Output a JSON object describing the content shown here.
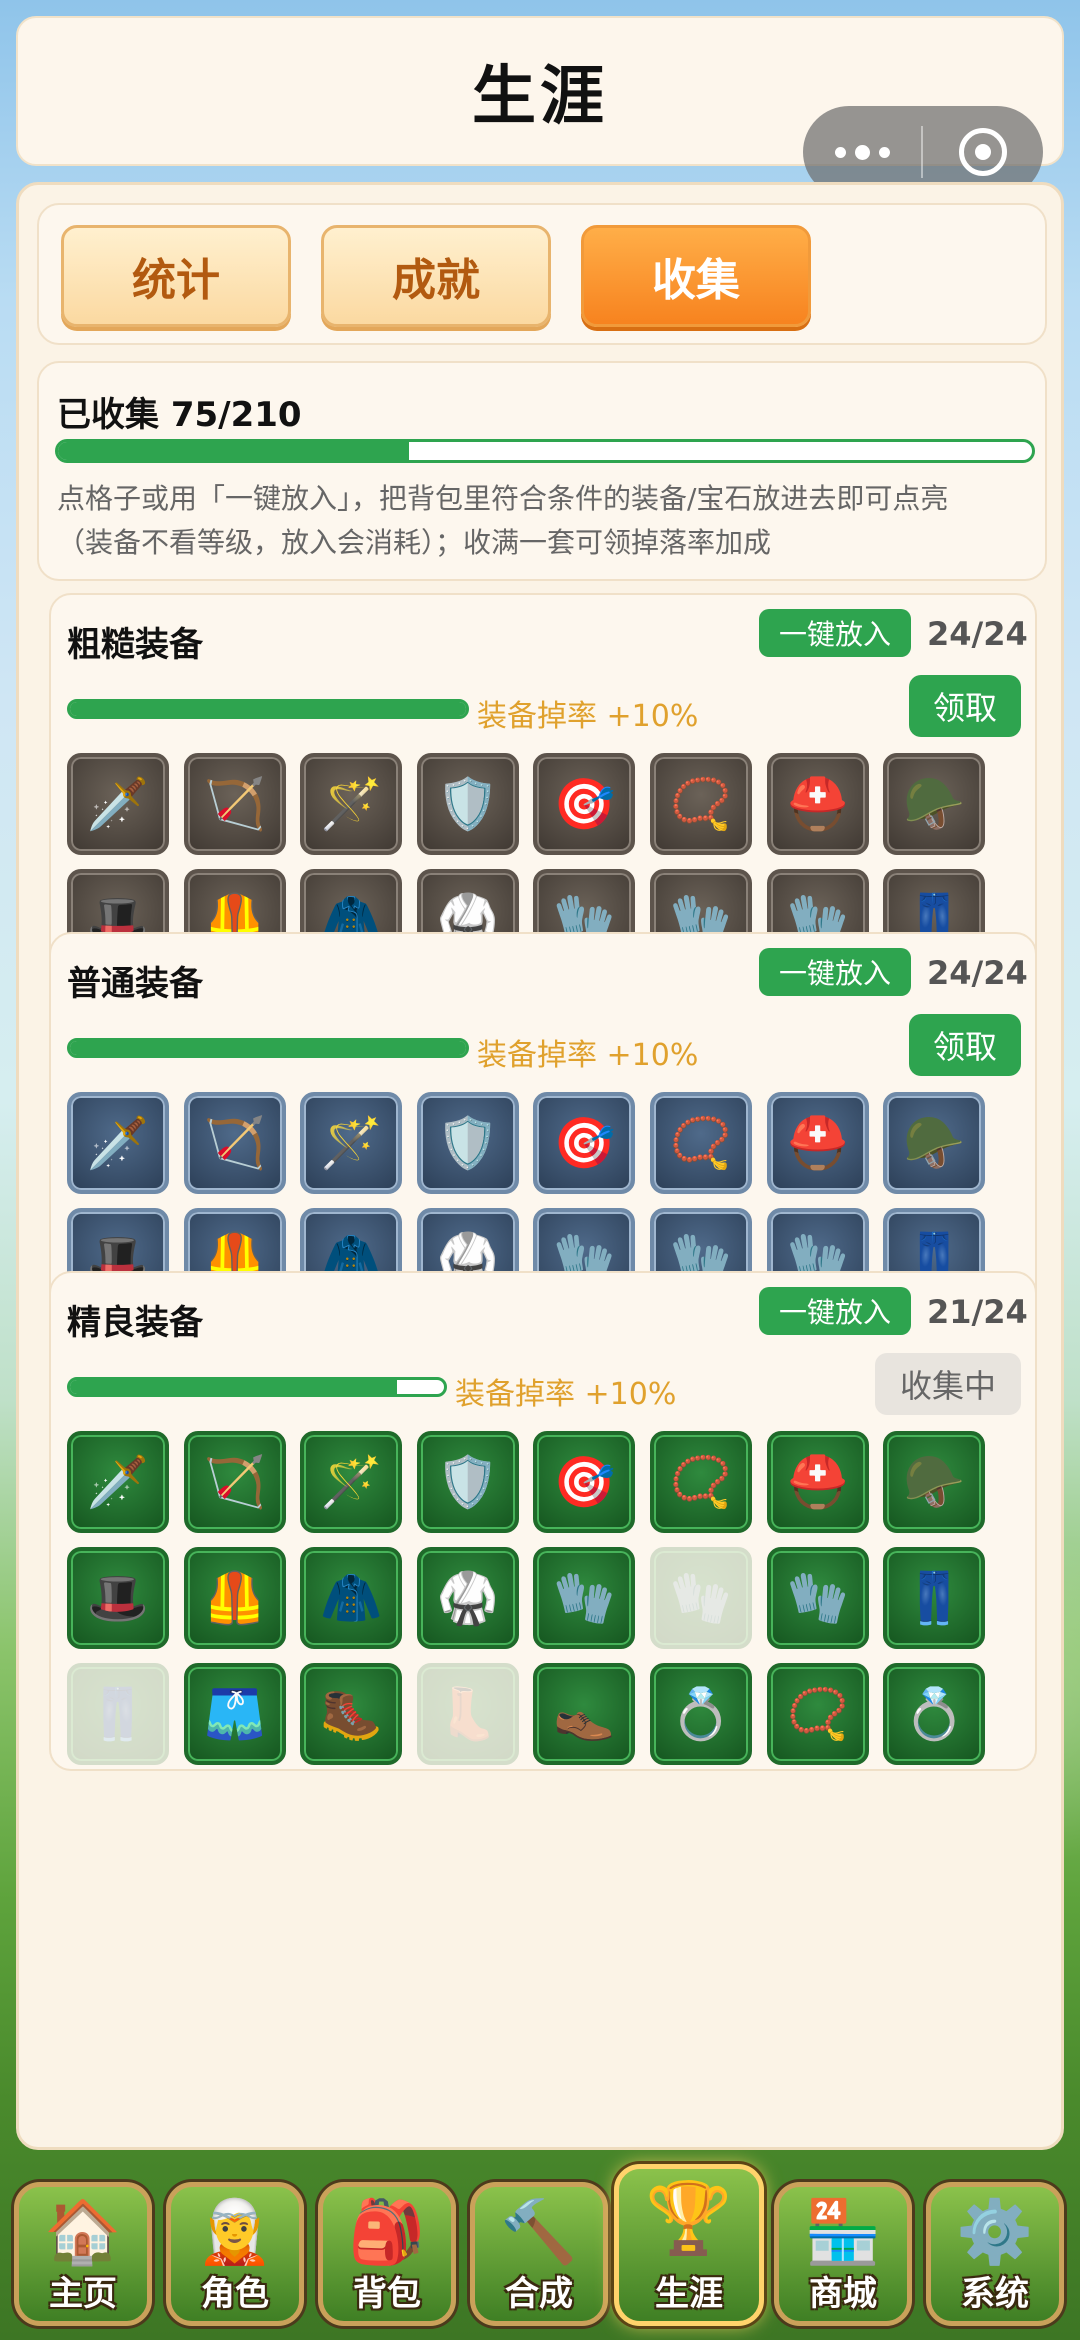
{
  "header": {
    "title": "生涯"
  },
  "tabs": [
    {
      "label": "统计",
      "active": false
    },
    {
      "label": "成就",
      "active": false
    },
    {
      "label": "收集",
      "active": true
    }
  ],
  "summary": {
    "label": "已收集 75/210",
    "progress": 0.36,
    "desc_line1": "点格子或用「一键放入」，把背包里符合条件的装备/宝石放进去即可点亮",
    "desc_line2": "（装备不看等级，放入会消耗）；收满一套可领掉落率加成"
  },
  "sets": [
    {
      "name": "粗糙装备",
      "put_label": "一键放入",
      "count": "24/24",
      "progress": 1.0,
      "bonus": "装备掉率 +10%",
      "claim_label": "领取",
      "claim_state": "ready",
      "tier": "rough",
      "items": [
        {
          "icon": "🗡️",
          "got": true
        },
        {
          "icon": "🏹",
          "got": true
        },
        {
          "icon": "🪄",
          "got": true
        },
        {
          "icon": "🛡️",
          "got": true
        },
        {
          "icon": "🎯",
          "got": true
        },
        {
          "icon": "📿",
          "got": true
        },
        {
          "icon": "⛑️",
          "got": true
        },
        {
          "icon": "🪖",
          "got": true
        },
        {
          "icon": "🎩",
          "got": true
        },
        {
          "icon": "🦺",
          "got": true
        },
        {
          "icon": "🧥",
          "got": true
        },
        {
          "icon": "🥋",
          "got": true
        },
        {
          "icon": "🧤",
          "got": true
        },
        {
          "icon": "🧤",
          "got": true
        },
        {
          "icon": "🧤",
          "got": true
        },
        {
          "icon": "👖",
          "got": true
        },
        {
          "icon": "👖",
          "got": true
        },
        {
          "icon": "🩳",
          "got": true
        },
        {
          "icon": "🥾",
          "got": true
        },
        {
          "icon": "👢",
          "got": true
        },
        {
          "icon": "👞",
          "got": true
        },
        {
          "icon": "💍",
          "got": true
        },
        {
          "icon": "📿",
          "got": true
        },
        {
          "icon": "💍",
          "got": true
        }
      ]
    },
    {
      "name": "普通装备",
      "put_label": "一键放入",
      "count": "24/24",
      "progress": 1.0,
      "bonus": "装备掉率 +10%",
      "claim_label": "领取",
      "claim_state": "ready",
      "tier": "normal",
      "items": [
        {
          "icon": "🗡️",
          "got": true
        },
        {
          "icon": "🏹",
          "got": true
        },
        {
          "icon": "🪄",
          "got": true
        },
        {
          "icon": "🛡️",
          "got": true
        },
        {
          "icon": "🎯",
          "got": true
        },
        {
          "icon": "📿",
          "got": true
        },
        {
          "icon": "⛑️",
          "got": true
        },
        {
          "icon": "🪖",
          "got": true
        },
        {
          "icon": "🎩",
          "got": true
        },
        {
          "icon": "🦺",
          "got": true
        },
        {
          "icon": "🧥",
          "got": true
        },
        {
          "icon": "🥋",
          "got": true
        },
        {
          "icon": "🧤",
          "got": true
        },
        {
          "icon": "🧤",
          "got": true
        },
        {
          "icon": "🧤",
          "got": true
        },
        {
          "icon": "👖",
          "got": true
        },
        {
          "icon": "👖",
          "got": true
        },
        {
          "icon": "🩳",
          "got": true
        },
        {
          "icon": "🥾",
          "got": true
        },
        {
          "icon": "👢",
          "got": true
        },
        {
          "icon": "👞",
          "got": true
        },
        {
          "icon": "💍",
          "got": true
        },
        {
          "icon": "📿",
          "got": true
        },
        {
          "icon": "💍",
          "got": true
        }
      ]
    },
    {
      "name": "精良装备",
      "put_label": "一键放入",
      "count": "21/24",
      "progress": 0.875,
      "bonus": "装备掉率 +10%",
      "claim_label": "收集中",
      "claim_state": "collecting",
      "tier": "fine",
      "items": [
        {
          "icon": "🗡️",
          "got": true
        },
        {
          "icon": "🏹",
          "got": true
        },
        {
          "icon": "🪄",
          "got": true
        },
        {
          "icon": "🛡️",
          "got": true
        },
        {
          "icon": "🎯",
          "got": true
        },
        {
          "icon": "📿",
          "got": true
        },
        {
          "icon": "⛑️",
          "got": true
        },
        {
          "icon": "🪖",
          "got": true
        },
        {
          "icon": "🎩",
          "got": true
        },
        {
          "icon": "🦺",
          "got": true
        },
        {
          "icon": "🧥",
          "got": true
        },
        {
          "icon": "🥋",
          "got": true
        },
        {
          "icon": "🧤",
          "got": true
        },
        {
          "icon": "🧤",
          "got": false
        },
        {
          "icon": "🧤",
          "got": true
        },
        {
          "icon": "👖",
          "got": true
        },
        {
          "icon": "👖",
          "got": false
        },
        {
          "icon": "🩳",
          "got": true
        },
        {
          "icon": "🥾",
          "got": true
        },
        {
          "icon": "👢",
          "got": false
        },
        {
          "icon": "👞",
          "got": true
        },
        {
          "icon": "💍",
          "got": true
        },
        {
          "icon": "📿",
          "got": true
        },
        {
          "icon": "💍",
          "got": true
        }
      ]
    }
  ],
  "nav": [
    {
      "label": "主页",
      "icon": "🏠",
      "active": false
    },
    {
      "label": "角色",
      "icon": "🧝",
      "active": false
    },
    {
      "label": "背包",
      "icon": "🎒",
      "active": false
    },
    {
      "label": "合成",
      "icon": "🔨",
      "active": false
    },
    {
      "label": "生涯",
      "icon": "🏆",
      "active": true
    },
    {
      "label": "商城",
      "icon": "🏪",
      "active": false
    },
    {
      "label": "系统",
      "icon": "⚙️",
      "active": false
    }
  ]
}
